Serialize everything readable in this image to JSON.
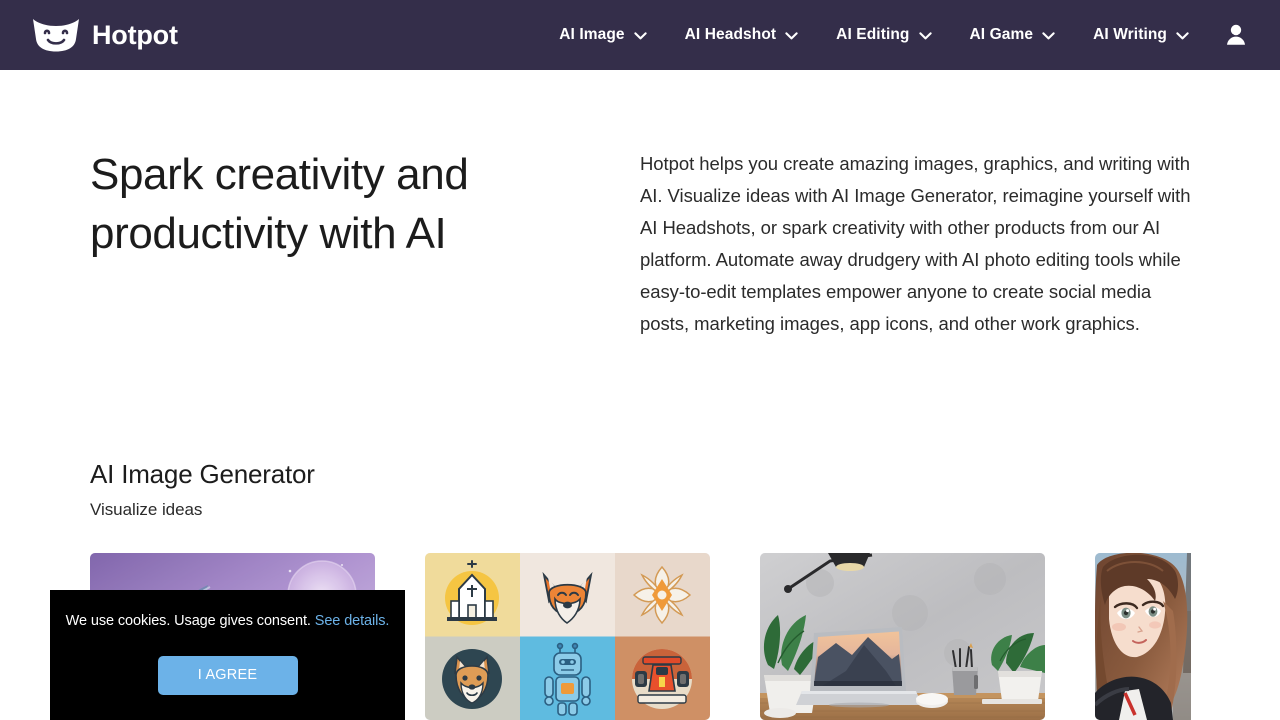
{
  "header": {
    "brand": {
      "name": "Hotpot",
      "logo_icon": "hotpot-bowl-smiley-icon"
    },
    "background_color": "#342E4A",
    "nav_items": [
      {
        "label": "AI Image",
        "icon": "chevron-down-icon"
      },
      {
        "label": "AI Headshot",
        "icon": "chevron-down-icon"
      },
      {
        "label": "AI Editing",
        "icon": "chevron-down-icon"
      },
      {
        "label": "AI Game",
        "icon": "chevron-down-icon"
      },
      {
        "label": "AI Writing",
        "icon": "chevron-down-icon"
      }
    ],
    "account": {
      "icon": "user-account-icon"
    }
  },
  "hero": {
    "title": "Spark creativity and productivity with AI",
    "body": "Hotpot helps you create amazing images, graphics, and writing with AI. Visualize ideas with AI Image Generator, reimagine yourself with AI Headshots, or spark creativity with other products from our AI platform. Automate away drudgery with AI photo editing tools while easy-to-edit templates empower anyone to create social media posts, marketing images, app icons, and other work graphics."
  },
  "section": {
    "title": "AI Image Generator",
    "subtitle": "Visualize ideas"
  },
  "gallery": {
    "items": [
      {
        "name": "purple-fantasy-dragon-artwork",
        "alt": "Purple fantasy dragon and moon artwork"
      },
      {
        "name": "flat-icon-grid-artwork",
        "alt": "Grid of flat illustrated icons: church, fox, flower, corgi, robot, race car"
      },
      {
        "name": "desk-laptop-photo",
        "alt": "Photo of a laptop on a wooden desk with plants and a lamp"
      },
      {
        "name": "anime-portrait-artwork",
        "alt": "Anime style portrait of a girl with brown hair"
      }
    ]
  },
  "cookie_banner": {
    "message": "We use cookies. Usage gives consent.",
    "link_label": "See details.",
    "agree_label": "I AGREE",
    "background_color": "#000000",
    "accent_color": "#6CB2E8"
  }
}
